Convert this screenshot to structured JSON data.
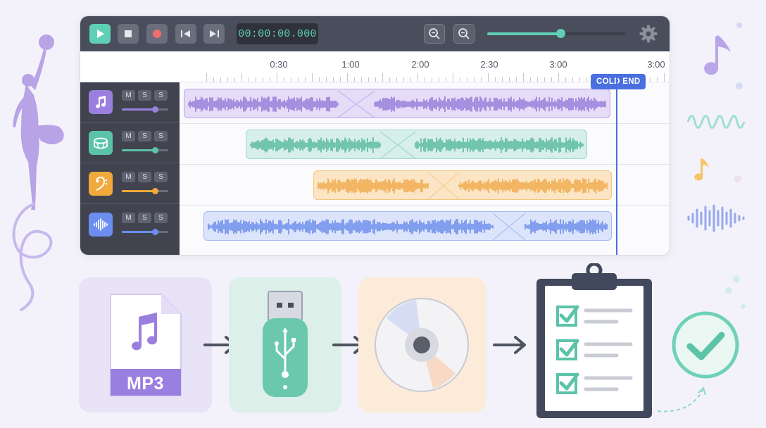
{
  "transport": {
    "play_icon": "play-icon",
    "stop_icon": "stop-icon",
    "record_icon": "record-icon",
    "rewind_icon": "skip-back-icon",
    "forward_icon": "skip-forward-icon",
    "time": "00:00:00.000",
    "zoom_out_icon": "zoom-out-icon",
    "zoom_in_icon": "zoom-in-icon",
    "master_volume": 0.53,
    "settings_icon": "gear-icon"
  },
  "timeline": {
    "ticks": [
      "0:30",
      "1:00",
      "2:00",
      "2:30",
      "3:00",
      "3:00"
    ],
    "marker_label": "COLD END"
  },
  "tracks": [
    {
      "icon": "music-note-icon",
      "color": "#9b7fe0",
      "mute": "M",
      "solo": "S",
      "third": "S",
      "volume": 0.71
    },
    {
      "icon": "drum-icon",
      "color": "#5cc3a8",
      "mute": "M",
      "solo": "S",
      "third": "S",
      "volume": 0.71
    },
    {
      "icon": "bass-clef-icon",
      "color": "#f2a93b",
      "mute": "M",
      "solo": "S",
      "third": "S",
      "volume": 0.71
    },
    {
      "icon": "waveform-icon",
      "color": "#6b8ef0",
      "mute": "M",
      "solo": "S",
      "third": "S",
      "volume": 0.71
    }
  ],
  "workflow": {
    "file_label": "MP3",
    "steps": [
      "mp3-file-icon",
      "usb-drive-icon",
      "cd-disc-icon",
      "checklist-clipboard-icon",
      "check-circle-icon"
    ]
  },
  "colors": {
    "accent": "#5fd0b5",
    "playhead": "#4a6fe0",
    "purple": "#9b7fe0",
    "teal": "#5cc3a8",
    "orange": "#f2a93b",
    "blue": "#6b8ef0"
  }
}
